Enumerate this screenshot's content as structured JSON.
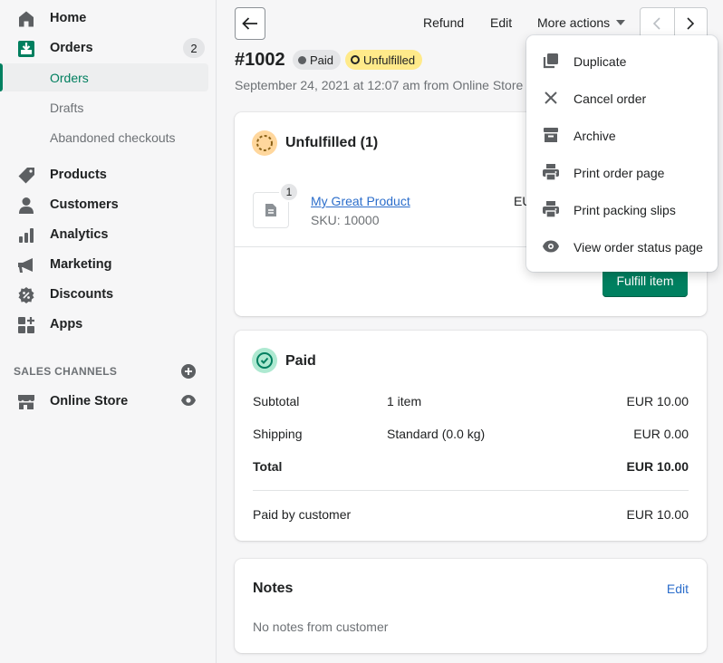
{
  "sidebar": {
    "items": [
      {
        "label": "Home",
        "icon": "home-icon"
      },
      {
        "label": "Orders",
        "icon": "orders-icon",
        "count": "2"
      },
      {
        "label": "Products",
        "icon": "tag-icon"
      },
      {
        "label": "Customers",
        "icon": "person-icon"
      },
      {
        "label": "Analytics",
        "icon": "bar-chart-icon"
      },
      {
        "label": "Marketing",
        "icon": "megaphone-icon"
      },
      {
        "label": "Discounts",
        "icon": "discount-icon"
      },
      {
        "label": "Apps",
        "icon": "apps-icon"
      }
    ],
    "orders_sub": [
      {
        "label": "Orders"
      },
      {
        "label": "Drafts"
      },
      {
        "label": "Abandoned checkouts"
      }
    ],
    "sales_channels_label": "SALES CHANNELS",
    "online_store": {
      "label": "Online Store",
      "icon": "store-icon"
    }
  },
  "header": {
    "refund": "Refund",
    "edit": "Edit",
    "more_actions": "More actions"
  },
  "order": {
    "title": "#1002",
    "paid_badge": "Paid",
    "unfulfilled_badge": "Unfulfilled",
    "subtitle": "September 24, 2021 at 12:07 am from Online Store"
  },
  "unfulfilled_card": {
    "title": "Unfulfilled (1)",
    "qty": "1",
    "product_name": "My Great Product",
    "sku": "SKU: 10000",
    "price_partial": "EU",
    "fulfill_button": "Fulfill item"
  },
  "paid_card": {
    "title": "Paid",
    "rows": [
      {
        "label": "Subtotal",
        "mid": "1 item",
        "value": "EUR 10.00"
      },
      {
        "label": "Shipping",
        "mid": "Standard (0.0 kg)",
        "value": "EUR 0.00"
      },
      {
        "label": "Total",
        "mid": "",
        "value": "EUR 10.00"
      }
    ],
    "paid_by_label": "Paid by customer",
    "paid_by_value": "EUR 10.00"
  },
  "notes_card": {
    "title": "Notes",
    "edit": "Edit",
    "empty": "No notes from customer"
  },
  "dropdown": {
    "items": [
      {
        "label": "Duplicate",
        "icon": "duplicate-icon"
      },
      {
        "label": "Cancel order",
        "icon": "close-icon"
      },
      {
        "label": "Archive",
        "icon": "archive-icon"
      },
      {
        "label": "Print order page",
        "icon": "printer-icon"
      },
      {
        "label": "Print packing slips",
        "icon": "printer-icon"
      },
      {
        "label": "View order status page",
        "icon": "eye-icon"
      }
    ]
  },
  "colors": {
    "accent": "#008060",
    "paid_badge_bg": "#e4e5e7",
    "unfulfilled_badge_bg": "#ffea8a",
    "link": "#2c6ecb"
  }
}
